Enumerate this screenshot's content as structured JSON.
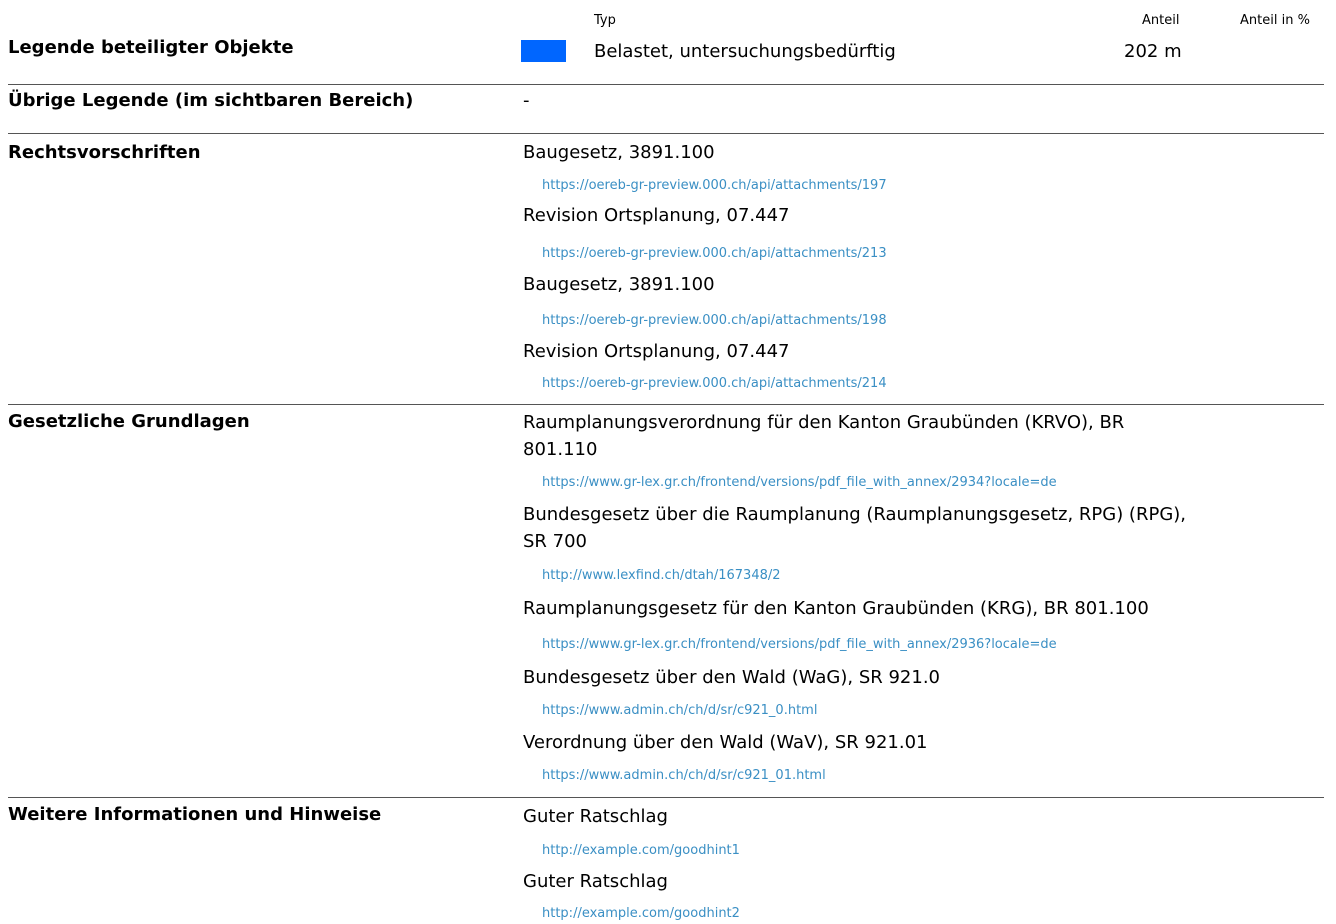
{
  "header": {
    "typ": "Typ",
    "anteil": "Anteil",
    "anteil_pct": "Anteil in %"
  },
  "legend": {
    "title": "Legende beteiligter Objekte",
    "swatch_color": "#0066ff",
    "type": "Belastet, untersuchungsbedürftig",
    "share": "202 m"
  },
  "other_legend": {
    "title": "Übrige Legende (im sichtbaren Bereich)",
    "value": "-"
  },
  "rechtsvorschriften": {
    "title": "Rechtsvorschriften",
    "items": [
      {
        "label": "Baugesetz, 3891.100",
        "url": "https://oereb-gr-preview.000.ch/api/attachments/197"
      },
      {
        "label": "Revision Ortsplanung, 07.447",
        "url": "https://oereb-gr-preview.000.ch/api/attachments/213"
      },
      {
        "label": "Baugesetz, 3891.100",
        "url": "https://oereb-gr-preview.000.ch/api/attachments/198"
      },
      {
        "label": "Revision Ortsplanung, 07.447",
        "url": "https://oereb-gr-preview.000.ch/api/attachments/214"
      }
    ]
  },
  "grundlagen": {
    "title": "Gesetzliche Grundlagen",
    "items": [
      {
        "label_line1": "Raumplanungsverordnung für den Kanton Graubünden (KRVO), BR",
        "label_line2": "801.110",
        "url": "https://www.gr-lex.gr.ch/frontend/versions/pdf_file_with_annex/2934?locale=de"
      },
      {
        "label_line1": "Bundesgesetz über die Raumplanung (Raumplanungsgesetz, RPG) (RPG),",
        "label_line2": "SR 700",
        "url": "http://www.lexfind.ch/dtah/167348/2"
      },
      {
        "label": "Raumplanungsgesetz für den Kanton Graubünden (KRG), BR 801.100",
        "url": "https://www.gr-lex.gr.ch/frontend/versions/pdf_file_with_annex/2936?locale=de"
      },
      {
        "label": "Bundesgesetz über den Wald (WaG), SR 921.0",
        "url": "https://www.admin.ch/ch/d/sr/c921_0.html"
      },
      {
        "label": "Verordnung über den Wald (WaV), SR 921.01",
        "url": "https://www.admin.ch/ch/d/sr/c921_01.html"
      }
    ]
  },
  "hinweise": {
    "title": "Weitere Informationen und Hinweise",
    "items": [
      {
        "label": "Guter Ratschlag",
        "url": "http://example.com/goodhint1"
      },
      {
        "label": "Guter Ratschlag",
        "url": "http://example.com/goodhint2"
      }
    ]
  }
}
